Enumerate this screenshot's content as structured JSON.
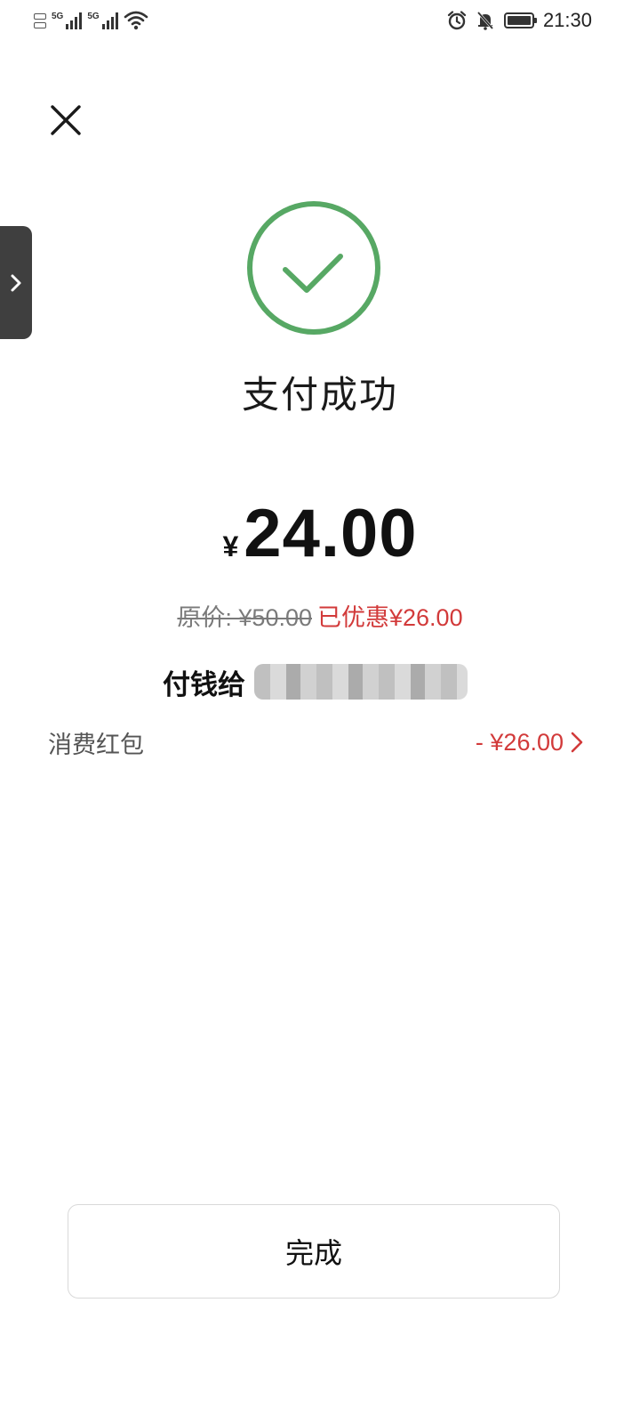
{
  "status_bar": {
    "network_1": "5G",
    "network_2": "5G",
    "time": "21:30",
    "icons": [
      "sim-icon",
      "signal-icon",
      "wifi-icon",
      "alarm-icon",
      "mute-icon",
      "battery-icon"
    ]
  },
  "header": {
    "close_icon": "close-icon"
  },
  "result": {
    "title": "支付成功",
    "icon": "check-circle-icon",
    "icon_color": "#57a864"
  },
  "payment": {
    "currency": "¥",
    "amount": "24.00",
    "original_price": "原价: ¥50.00",
    "discount_text": "已优惠¥26.00",
    "discount_color": "#d23a3a",
    "payee_label": "付钱给"
  },
  "rows": [
    {
      "label": "消费红包",
      "value": "- ¥26.00"
    }
  ],
  "footer": {
    "done_label": "完成"
  }
}
